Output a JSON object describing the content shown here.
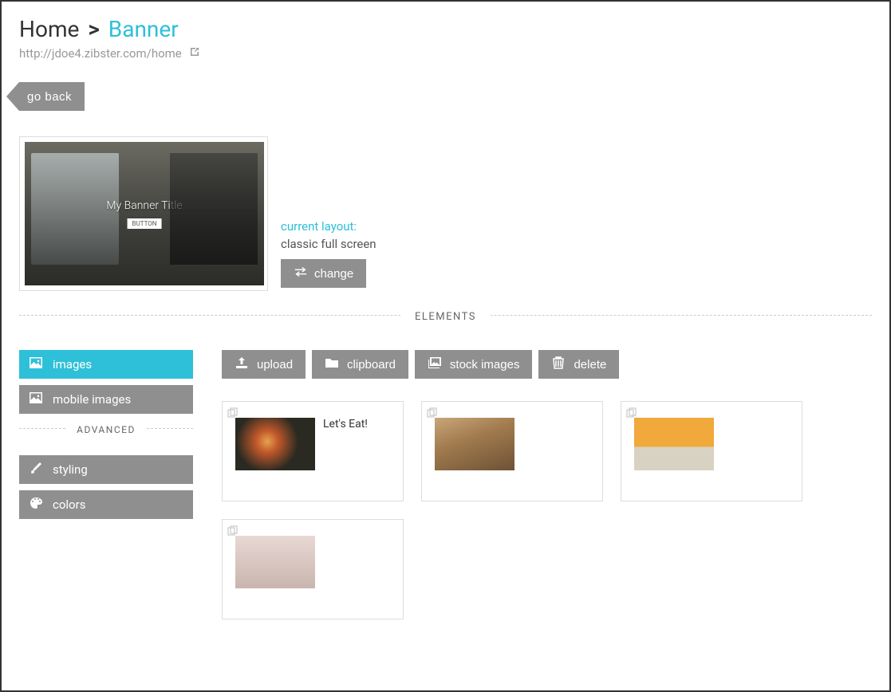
{
  "breadcrumb": {
    "root": "Home",
    "sep": ">",
    "current": "Banner"
  },
  "page_url": "http://jdoe4.zibster.com/home",
  "go_back_label": "go back",
  "preview": {
    "title_overlay": "My Banner Title",
    "button_overlay": "BUTTON"
  },
  "layout": {
    "label": "current layout:",
    "value": "classic full screen",
    "change_label": "change"
  },
  "elements_divider": "ELEMENTS",
  "sidebar": {
    "items": [
      {
        "id": "images",
        "label": "images",
        "active": true
      },
      {
        "id": "mobile-images",
        "label": "mobile images",
        "active": false
      }
    ],
    "advanced_divider": "ADVANCED",
    "advanced_items": [
      {
        "id": "styling",
        "label": "styling"
      },
      {
        "id": "colors",
        "label": "colors"
      }
    ]
  },
  "toolbar": {
    "upload": "upload",
    "clipboard": "clipboard",
    "stock_images": "stock images",
    "delete": "delete"
  },
  "cards": [
    {
      "id": "food",
      "label": "Let's Eat!"
    },
    {
      "id": "table",
      "label": ""
    },
    {
      "id": "beer",
      "label": ""
    },
    {
      "id": "people",
      "label": ""
    }
  ]
}
